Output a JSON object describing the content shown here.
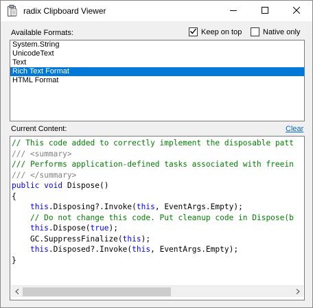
{
  "window": {
    "title": "radix Clipboard Viewer",
    "icon": "clipboard-icon",
    "controls": [
      "minimize-icon",
      "maximize-icon",
      "close-icon"
    ]
  },
  "formats": {
    "label": "Available Formats:",
    "keep_on_top": {
      "label": "Keep on top",
      "checked": true
    },
    "native_only": {
      "label": "Native only",
      "checked": false
    },
    "items": [
      {
        "label": "System.String"
      },
      {
        "label": "UnicodeText"
      },
      {
        "label": "Text"
      },
      {
        "label": "Rich Text Format",
        "selected": true
      },
      {
        "label": "HTML Format"
      }
    ]
  },
  "content": {
    "label": "Current Content:",
    "clear_label": "Clear",
    "lines": [
      [
        {
          "t": "// This code added to correctly implement the disposable patt",
          "c": "comment"
        }
      ],
      [
        {
          "t": "/// <summary>",
          "c": "doc"
        }
      ],
      [
        {
          "t": "/// Performs application-defined tasks associated with freein",
          "c": "comment"
        }
      ],
      [
        {
          "t": "/// </summary>",
          "c": "doc"
        }
      ],
      [
        {
          "t": "public void",
          "c": "kw"
        },
        {
          "t": " Dispose()",
          "c": "plain"
        }
      ],
      [
        {
          "t": "{",
          "c": "plain"
        }
      ],
      [
        {
          "t": "    ",
          "c": "plain"
        },
        {
          "t": "this",
          "c": "kw"
        },
        {
          "t": ".Disposing?.Invoke(",
          "c": "plain"
        },
        {
          "t": "this",
          "c": "kw"
        },
        {
          "t": ", EventArgs.Empty);",
          "c": "plain"
        }
      ],
      [
        {
          "t": "    // Do not change this code. Put cleanup code in Dispose(b",
          "c": "comment"
        }
      ],
      [
        {
          "t": "    ",
          "c": "plain"
        },
        {
          "t": "this",
          "c": "kw"
        },
        {
          "t": ".Dispose(",
          "c": "plain"
        },
        {
          "t": "true",
          "c": "kw"
        },
        {
          "t": ");",
          "c": "plain"
        }
      ],
      [
        {
          "t": "    GC.SuppressFinalize(",
          "c": "plain"
        },
        {
          "t": "this",
          "c": "kw"
        },
        {
          "t": ");",
          "c": "plain"
        }
      ],
      [
        {
          "t": "    ",
          "c": "plain"
        },
        {
          "t": "this",
          "c": "kw"
        },
        {
          "t": ".Disposed?.Invoke(",
          "c": "plain"
        },
        {
          "t": "this",
          "c": "kw"
        },
        {
          "t": ", EventArgs.Empty);",
          "c": "plain"
        }
      ],
      [
        {
          "t": "}",
          "c": "plain"
        }
      ]
    ],
    "scrollbar": {
      "thumb_fraction": 0.55
    }
  },
  "colors": {
    "selection": "#0078d7",
    "comment": "#008000",
    "doc": "#808080",
    "keyword": "#0000ff",
    "link": "#0066cc"
  }
}
